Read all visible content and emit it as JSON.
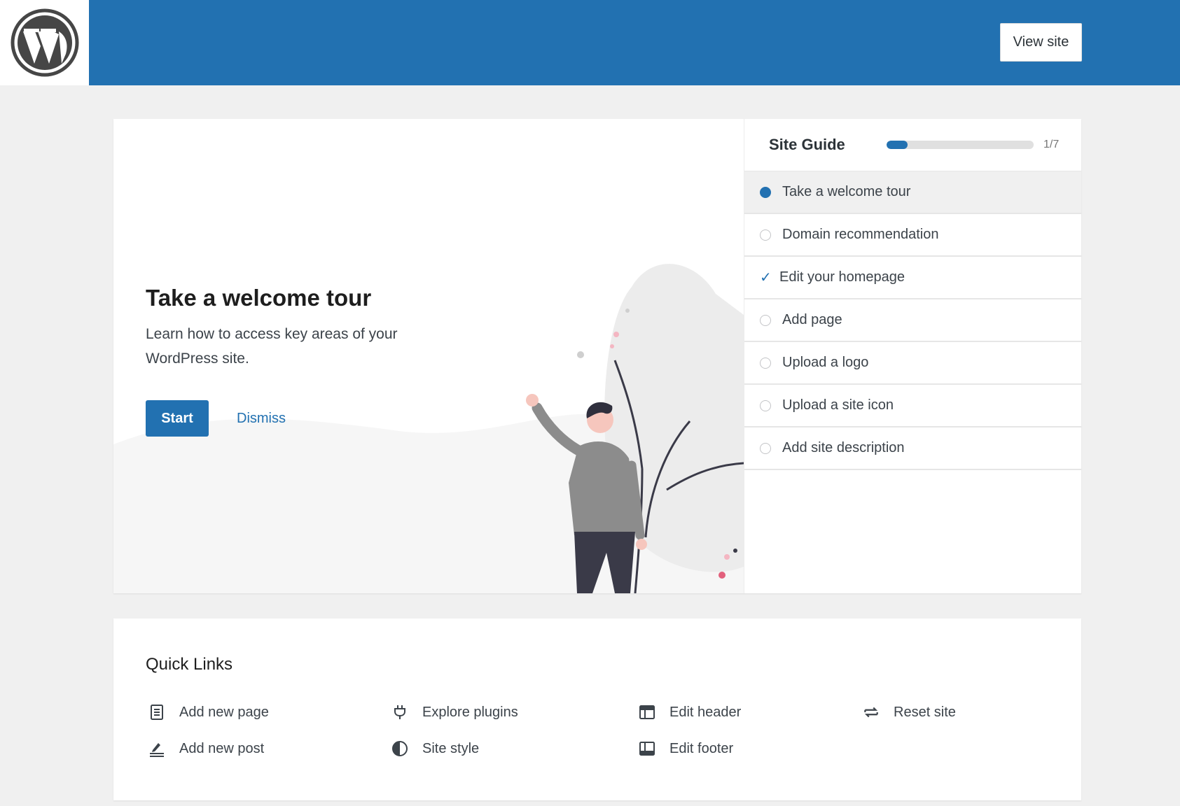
{
  "header": {
    "view_site_label": "View site"
  },
  "tour": {
    "title": "Take a welcome tour",
    "description": "Learn how to access key areas of your WordPress site.",
    "start_label": "Start",
    "dismiss_label": "Dismiss"
  },
  "site_guide": {
    "title": "Site Guide",
    "progress_text": "1/7",
    "progress_fraction": 0.143,
    "items": [
      {
        "label": "Take a welcome tour",
        "state": "current"
      },
      {
        "label": "Domain recommendation",
        "state": "todo"
      },
      {
        "label": "Edit your homepage",
        "state": "done"
      },
      {
        "label": "Add page",
        "state": "todo"
      },
      {
        "label": "Upload a logo",
        "state": "todo"
      },
      {
        "label": "Upload a site icon",
        "state": "todo"
      },
      {
        "label": "Add site description",
        "state": "todo"
      }
    ]
  },
  "quick_links": {
    "title": "Quick Links",
    "items": [
      {
        "label": "Add new page",
        "icon": "page-icon"
      },
      {
        "label": "Add new post",
        "icon": "post-icon"
      },
      {
        "label": "Explore plugins",
        "icon": "plugin-icon"
      },
      {
        "label": "Site style",
        "icon": "contrast-icon"
      },
      {
        "label": "Edit header",
        "icon": "header-icon"
      },
      {
        "label": "Edit footer",
        "icon": "footer-icon"
      },
      {
        "label": "Reset site",
        "icon": "reset-icon"
      }
    ]
  },
  "colors": {
    "accent": "#2271b1",
    "background": "#f0f0f0",
    "highlight": "#e2607c"
  }
}
